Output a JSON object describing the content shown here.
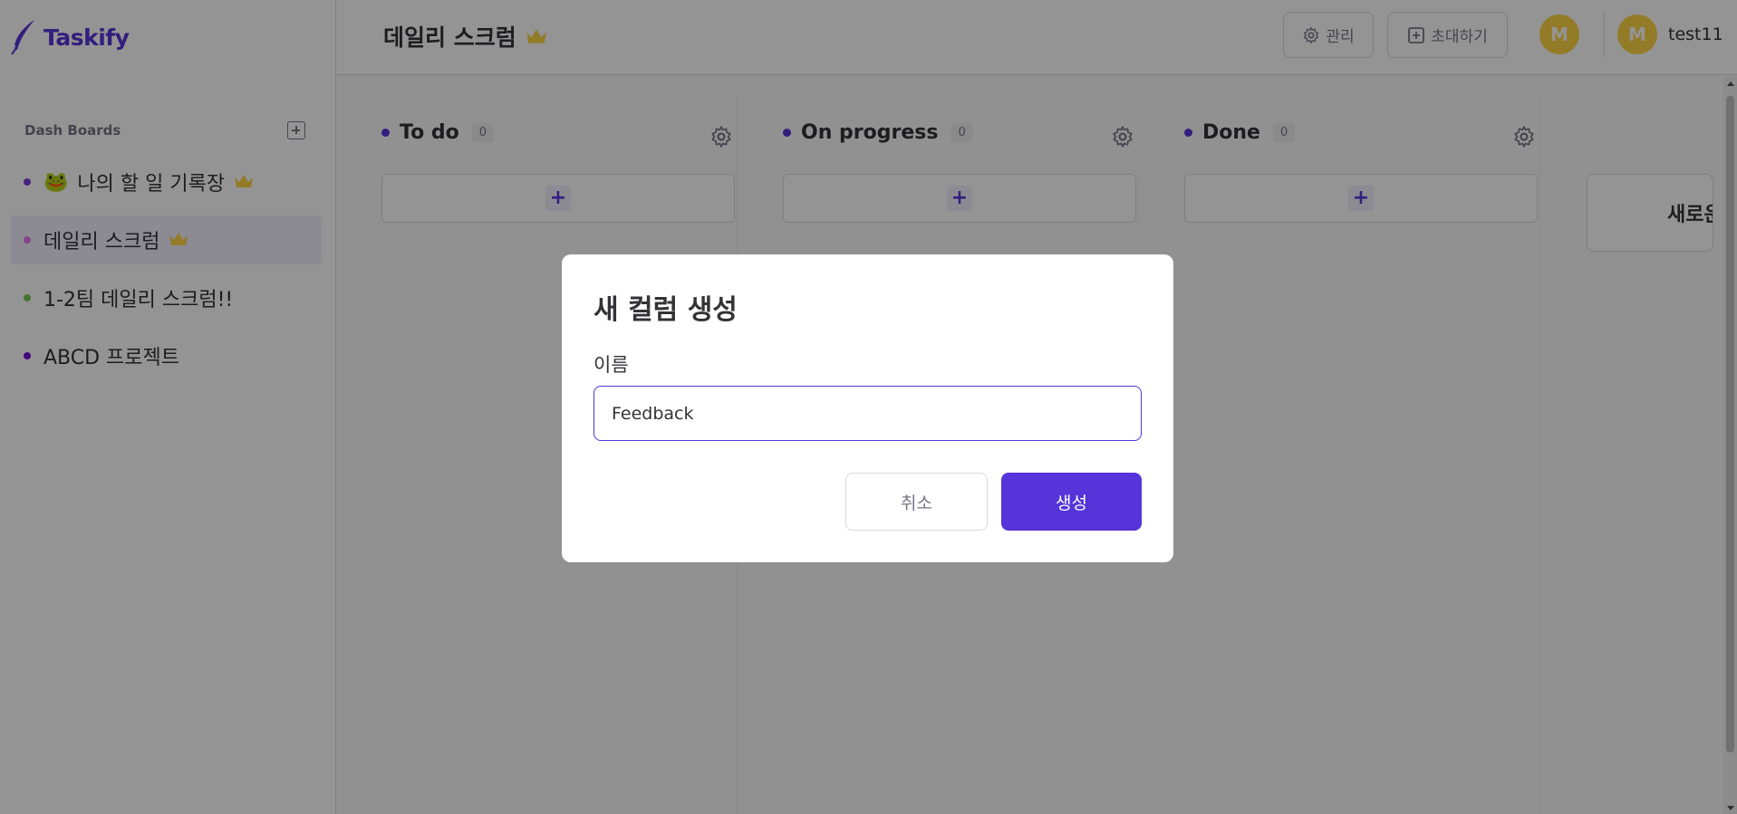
{
  "app": {
    "logo_text": "Taskify"
  },
  "sidebar": {
    "section_title": "Dash Boards",
    "boards": [
      {
        "emoji": "🐸",
        "label": "나의 할 일 기록장",
        "owner": true,
        "dot_color": "#7a3dd8",
        "active": false
      },
      {
        "label": "데일리 스크럼",
        "owner": true,
        "dot_color": "#e876ea",
        "active": true
      },
      {
        "label": "1-2팀 데일리 스크럼!!",
        "owner": false,
        "dot_color": "#7ac555",
        "active": false
      },
      {
        "label": "ABCD 프로젝트",
        "owner": false,
        "dot_color": "#760dde",
        "active": false
      }
    ]
  },
  "header": {
    "title": "데일리 스크럼",
    "manage_label": "관리",
    "invite_label": "초대하기",
    "member_initial": "M",
    "user_initial": "M",
    "username": "test11"
  },
  "columns": [
    {
      "title": "To do",
      "count": "0"
    },
    {
      "title": "On progress",
      "count": "0"
    },
    {
      "title": "Done",
      "count": "0"
    }
  ],
  "add_column_label": "새로운 컬럼 추가하기",
  "modal": {
    "title": "새 컬럼 생성",
    "name_label": "이름",
    "name_value": "Feedback",
    "cancel_label": "취소",
    "create_label": "생성"
  },
  "colors": {
    "brand": "#5534da",
    "crown": "#fdd446",
    "avatar": "#fdd446"
  }
}
